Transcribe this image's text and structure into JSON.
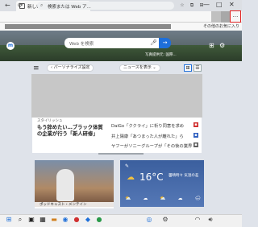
{
  "tab": {
    "title": "新しいタブ",
    "close": "✕"
  },
  "window": {
    "new_tab": "+",
    "minimize": "—",
    "maximize": "□",
    "close": "✕"
  },
  "addr": {
    "back": "←",
    "refresh": "⟳",
    "url": "検索または Web ア...",
    "menu": "..."
  },
  "favorites": {
    "other": "その他のお気に入り"
  },
  "search": {
    "placeholder": "Web を検索"
  },
  "hero": {
    "caption": "写真提供元: 国際..."
  },
  "toolbar": {
    "personalize": "パーソナライズ設定",
    "news": "ニュースを表示"
  },
  "news": {
    "tag": "スタイリッシュ",
    "headline": "もう辞めたい…ブラック体質の企業が行う「新人研修」",
    "items": [
      "DaiGo「ククライ」に祈り同意を求め",
      "井上陽康「あつまった人が離れた」ら",
      "ヤフーがソニーグループが「その後の業界"
    ]
  },
  "card": {
    "caption": "ポッドキャスト・メンテイン"
  },
  "weather": {
    "temp": "16°C",
    "condition": "曇晴時々 気温の差",
    "days": [
      "⛅",
      "☁",
      "⛅",
      "☁",
      "🌧"
    ]
  },
  "colors": {
    "accent": "#1e6fd9",
    "highlight": "#e02020"
  }
}
